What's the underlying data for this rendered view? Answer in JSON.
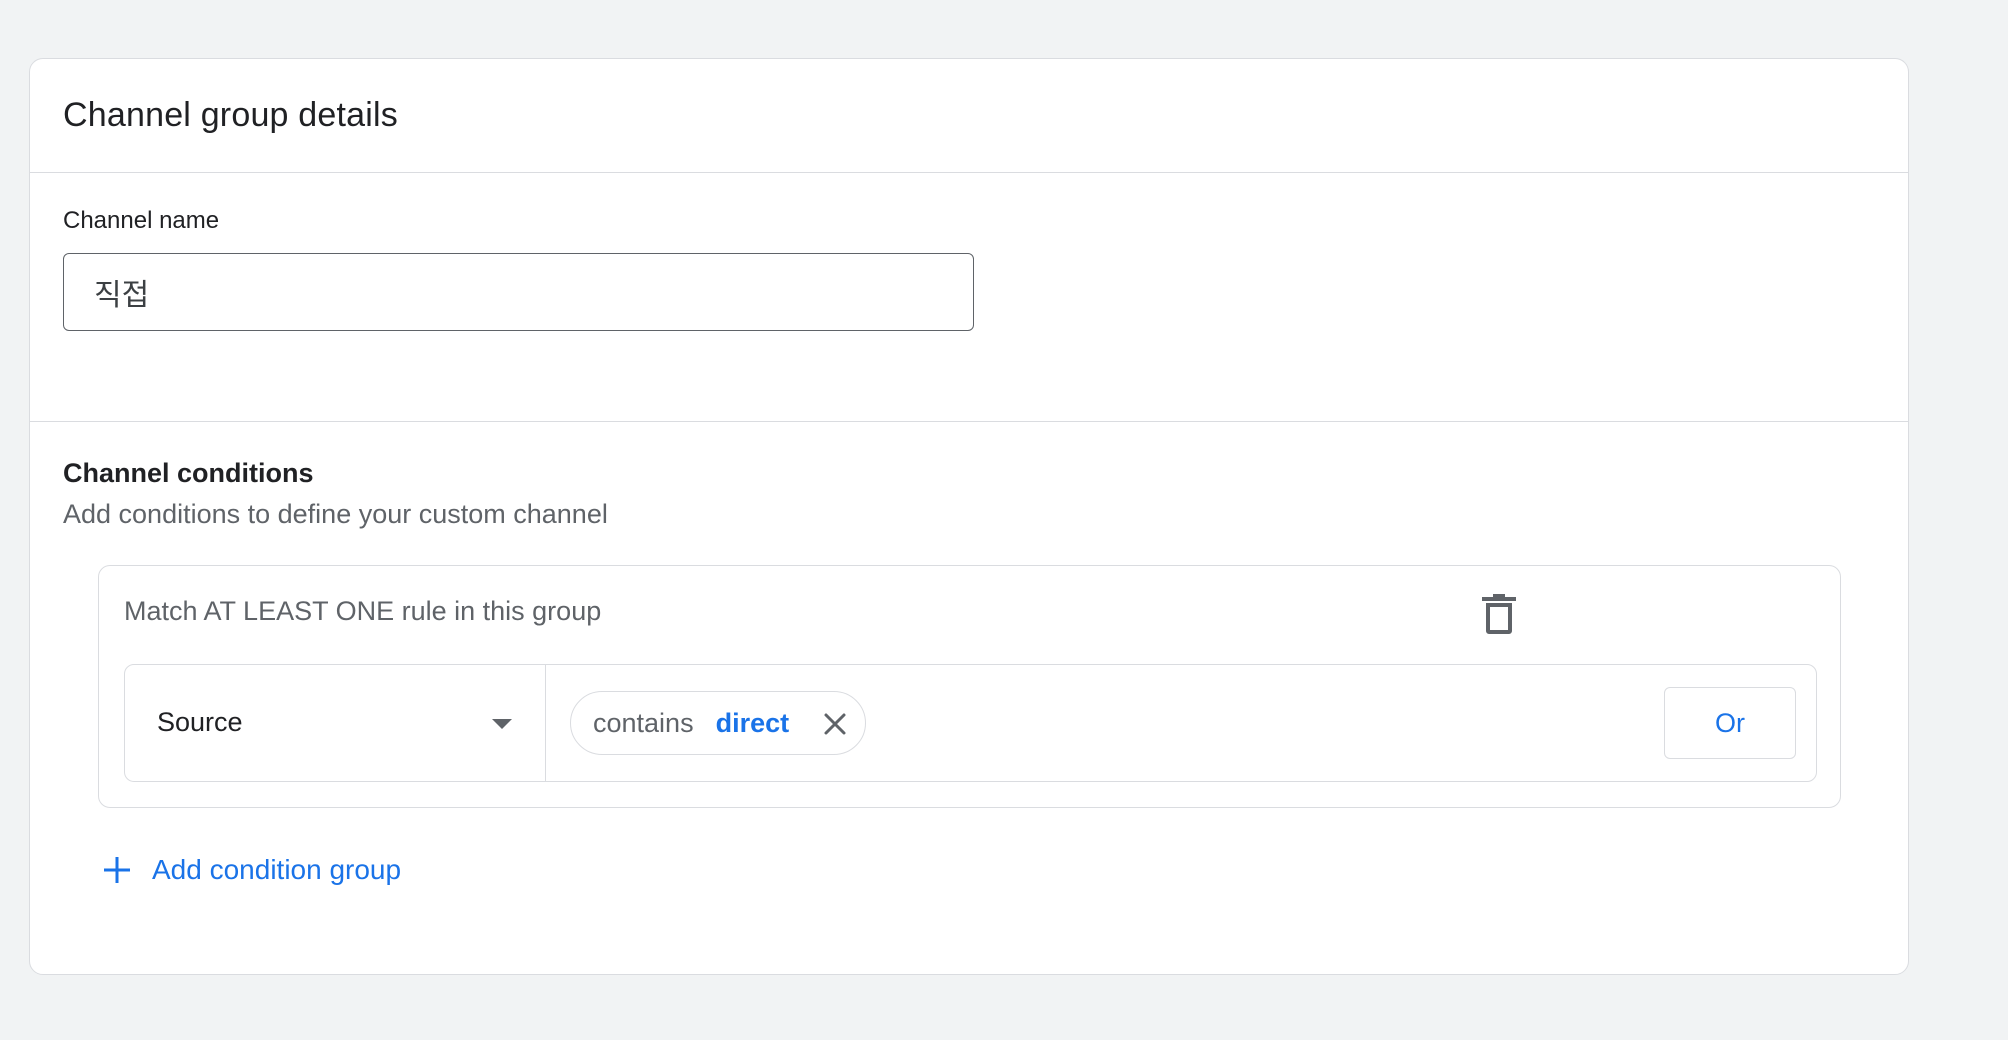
{
  "card": {
    "title": "Channel group details"
  },
  "channel_name": {
    "label": "Channel name",
    "value": "직접"
  },
  "conditions": {
    "title": "Channel conditions",
    "subtitle": "Add conditions to define your custom channel",
    "group": {
      "label": "Match AT LEAST ONE rule in this group",
      "rule": {
        "dimension": "Source",
        "chip": {
          "operator": "contains",
          "value": "direct"
        },
        "or_label": "Or"
      }
    },
    "add_group_label": "Add condition group"
  },
  "colors": {
    "accent": "#1a73e8",
    "border": "#dadce0",
    "muted_text": "#5f6368"
  },
  "icons": {
    "delete": "trash-icon",
    "remove_chip": "close-icon",
    "dropdown": "chevron-down-icon",
    "add": "plus-icon"
  }
}
